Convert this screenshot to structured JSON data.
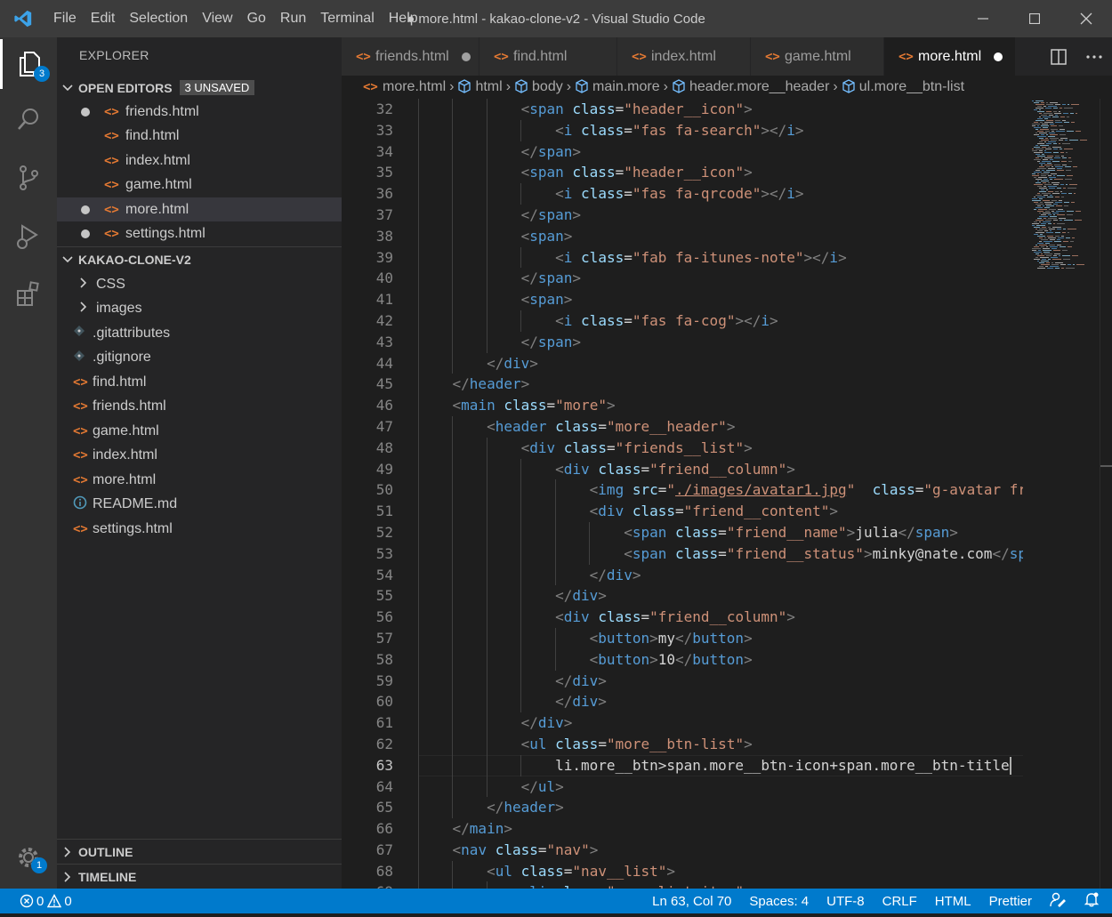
{
  "window": {
    "title": "● more.html - kakao-clone-v2 - Visual Studio Code",
    "menu": [
      "File",
      "Edit",
      "Selection",
      "View",
      "Go",
      "Run",
      "Terminal",
      "Help"
    ]
  },
  "activity_bar": {
    "explorer_badge": "3",
    "settings_badge": "1"
  },
  "sidebar": {
    "title": "EXPLORER",
    "open_editors": {
      "label": "OPEN EDITORS",
      "badge": "3 UNSAVED",
      "items": [
        {
          "name": "friends.html",
          "unsaved": true
        },
        {
          "name": "find.html",
          "unsaved": false
        },
        {
          "name": "index.html",
          "unsaved": false
        },
        {
          "name": "game.html",
          "unsaved": false
        },
        {
          "name": "more.html",
          "unsaved": true
        },
        {
          "name": "settings.html",
          "unsaved": true
        }
      ]
    },
    "project": {
      "label": "KAKAO-CLONE-V2",
      "folders": [
        "CSS",
        "images"
      ],
      "files": [
        {
          "name": ".gitattributes",
          "icon": "git"
        },
        {
          "name": ".gitignore",
          "icon": "git"
        },
        {
          "name": "find.html",
          "icon": "html"
        },
        {
          "name": "friends.html",
          "icon": "html"
        },
        {
          "name": "game.html",
          "icon": "html"
        },
        {
          "name": "index.html",
          "icon": "html"
        },
        {
          "name": "more.html",
          "icon": "html"
        },
        {
          "name": "README.md",
          "icon": "info"
        },
        {
          "name": "settings.html",
          "icon": "html"
        }
      ]
    },
    "outline_label": "OUTLINE",
    "timeline_label": "TIMELINE"
  },
  "tabs": [
    {
      "name": "friends.html",
      "unsaved": true,
      "active": false
    },
    {
      "name": "find.html",
      "unsaved": false,
      "active": false
    },
    {
      "name": "index.html",
      "unsaved": false,
      "active": false
    },
    {
      "name": "game.html",
      "unsaved": false,
      "active": false
    },
    {
      "name": "more.html",
      "unsaved": true,
      "active": true
    }
  ],
  "breadcrumb": [
    "more.html",
    "html",
    "body",
    "main.more",
    "header.more__header",
    "ul.more__btn-list"
  ],
  "editor": {
    "current_line": 63,
    "lines": [
      {
        "n": 32,
        "indent": 3,
        "tokens": [
          [
            "p",
            "<"
          ],
          [
            "t",
            "span"
          ],
          [
            "tx",
            " "
          ],
          [
            "a",
            "class"
          ],
          [
            "tx",
            "="
          ],
          [
            "s",
            "\"header__icon\""
          ],
          [
            "p",
            ">"
          ]
        ]
      },
      {
        "n": 33,
        "indent": 4,
        "tokens": [
          [
            "p",
            "<"
          ],
          [
            "t",
            "i"
          ],
          [
            "tx",
            " "
          ],
          [
            "a",
            "class"
          ],
          [
            "tx",
            "="
          ],
          [
            "s",
            "\"fas fa-search\""
          ],
          [
            "p",
            "></"
          ],
          [
            "t",
            "i"
          ],
          [
            "p",
            ">"
          ]
        ]
      },
      {
        "n": 34,
        "indent": 3,
        "tokens": [
          [
            "p",
            "</"
          ],
          [
            "t",
            "span"
          ],
          [
            "p",
            ">"
          ]
        ]
      },
      {
        "n": 35,
        "indent": 3,
        "tokens": [
          [
            "p",
            "<"
          ],
          [
            "t",
            "span"
          ],
          [
            "tx",
            " "
          ],
          [
            "a",
            "class"
          ],
          [
            "tx",
            "="
          ],
          [
            "s",
            "\"header__icon\""
          ],
          [
            "p",
            ">"
          ]
        ]
      },
      {
        "n": 36,
        "indent": 4,
        "tokens": [
          [
            "p",
            "<"
          ],
          [
            "t",
            "i"
          ],
          [
            "tx",
            " "
          ],
          [
            "a",
            "class"
          ],
          [
            "tx",
            "="
          ],
          [
            "s",
            "\"fas fa-qrcode\""
          ],
          [
            "p",
            "></"
          ],
          [
            "t",
            "i"
          ],
          [
            "p",
            ">"
          ]
        ]
      },
      {
        "n": 37,
        "indent": 3,
        "tokens": [
          [
            "p",
            "</"
          ],
          [
            "t",
            "span"
          ],
          [
            "p",
            ">"
          ]
        ]
      },
      {
        "n": 38,
        "indent": 3,
        "tokens": [
          [
            "p",
            "<"
          ],
          [
            "t",
            "span"
          ],
          [
            "p",
            ">"
          ]
        ]
      },
      {
        "n": 39,
        "indent": 4,
        "tokens": [
          [
            "p",
            "<"
          ],
          [
            "t",
            "i"
          ],
          [
            "tx",
            " "
          ],
          [
            "a",
            "class"
          ],
          [
            "tx",
            "="
          ],
          [
            "s",
            "\"fab fa-itunes-note\""
          ],
          [
            "p",
            "></"
          ],
          [
            "t",
            "i"
          ],
          [
            "p",
            ">"
          ]
        ]
      },
      {
        "n": 40,
        "indent": 3,
        "tokens": [
          [
            "p",
            "</"
          ],
          [
            "t",
            "span"
          ],
          [
            "p",
            ">"
          ]
        ]
      },
      {
        "n": 41,
        "indent": 3,
        "tokens": [
          [
            "p",
            "<"
          ],
          [
            "t",
            "span"
          ],
          [
            "p",
            ">"
          ]
        ]
      },
      {
        "n": 42,
        "indent": 4,
        "tokens": [
          [
            "p",
            "<"
          ],
          [
            "t",
            "i"
          ],
          [
            "tx",
            " "
          ],
          [
            "a",
            "class"
          ],
          [
            "tx",
            "="
          ],
          [
            "s",
            "\"fas fa-cog\""
          ],
          [
            "p",
            "></"
          ],
          [
            "t",
            "i"
          ],
          [
            "p",
            ">"
          ]
        ]
      },
      {
        "n": 43,
        "indent": 3,
        "tokens": [
          [
            "p",
            "</"
          ],
          [
            "t",
            "span"
          ],
          [
            "p",
            ">"
          ]
        ]
      },
      {
        "n": 44,
        "indent": 2,
        "tokens": [
          [
            "p",
            "</"
          ],
          [
            "t",
            "div"
          ],
          [
            "p",
            ">"
          ]
        ]
      },
      {
        "n": 45,
        "indent": 1,
        "tokens": [
          [
            "p",
            "</"
          ],
          [
            "t",
            "header"
          ],
          [
            "p",
            ">"
          ]
        ]
      },
      {
        "n": 46,
        "indent": 1,
        "tokens": [
          [
            "p",
            "<"
          ],
          [
            "t",
            "main"
          ],
          [
            "tx",
            " "
          ],
          [
            "a",
            "class"
          ],
          [
            "tx",
            "="
          ],
          [
            "s",
            "\"more\""
          ],
          [
            "p",
            ">"
          ]
        ]
      },
      {
        "n": 47,
        "indent": 2,
        "tokens": [
          [
            "p",
            "<"
          ],
          [
            "t",
            "header"
          ],
          [
            "tx",
            " "
          ],
          [
            "a",
            "class"
          ],
          [
            "tx",
            "="
          ],
          [
            "s",
            "\"more__header\""
          ],
          [
            "p",
            ">"
          ]
        ]
      },
      {
        "n": 48,
        "indent": 3,
        "tokens": [
          [
            "p",
            "<"
          ],
          [
            "t",
            "div"
          ],
          [
            "tx",
            " "
          ],
          [
            "a",
            "class"
          ],
          [
            "tx",
            "="
          ],
          [
            "s",
            "\"friends__list\""
          ],
          [
            "p",
            ">"
          ]
        ]
      },
      {
        "n": 49,
        "indent": 4,
        "tokens": [
          [
            "p",
            "<"
          ],
          [
            "t",
            "div"
          ],
          [
            "tx",
            " "
          ],
          [
            "a",
            "class"
          ],
          [
            "tx",
            "="
          ],
          [
            "s",
            "\"friend__column\""
          ],
          [
            "p",
            ">"
          ]
        ]
      },
      {
        "n": 50,
        "indent": 5,
        "tokens": [
          [
            "p",
            "<"
          ],
          [
            "t",
            "img"
          ],
          [
            "tx",
            " "
          ],
          [
            "a",
            "src"
          ],
          [
            "tx",
            "="
          ],
          [
            "s",
            "\""
          ],
          [
            "su",
            "./images/avatar1.jpg"
          ],
          [
            "s",
            "\""
          ],
          [
            "tx",
            "  "
          ],
          [
            "a",
            "class"
          ],
          [
            "tx",
            "="
          ],
          [
            "s",
            "\"g-avatar fr"
          ]
        ]
      },
      {
        "n": 51,
        "indent": 5,
        "tokens": [
          [
            "p",
            "<"
          ],
          [
            "t",
            "div"
          ],
          [
            "tx",
            " "
          ],
          [
            "a",
            "class"
          ],
          [
            "tx",
            "="
          ],
          [
            "s",
            "\"friend__content\""
          ],
          [
            "p",
            ">"
          ]
        ]
      },
      {
        "n": 52,
        "indent": 6,
        "tokens": [
          [
            "p",
            "<"
          ],
          [
            "t",
            "span"
          ],
          [
            "tx",
            " "
          ],
          [
            "a",
            "class"
          ],
          [
            "tx",
            "="
          ],
          [
            "s",
            "\"friend__name\""
          ],
          [
            "p",
            ">"
          ],
          [
            "tx",
            "julia"
          ],
          [
            "p",
            "</"
          ],
          [
            "t",
            "span"
          ],
          [
            "p",
            ">"
          ]
        ]
      },
      {
        "n": 53,
        "indent": 6,
        "tokens": [
          [
            "p",
            "<"
          ],
          [
            "t",
            "span"
          ],
          [
            "tx",
            " "
          ],
          [
            "a",
            "class"
          ],
          [
            "tx",
            "="
          ],
          [
            "s",
            "\"friend__status\""
          ],
          [
            "p",
            ">"
          ],
          [
            "tx",
            "minky@nate.com"
          ],
          [
            "p",
            "</"
          ],
          [
            "t",
            "sp"
          ]
        ]
      },
      {
        "n": 54,
        "indent": 5,
        "tokens": [
          [
            "p",
            "</"
          ],
          [
            "t",
            "div"
          ],
          [
            "p",
            ">"
          ]
        ]
      },
      {
        "n": 55,
        "indent": 4,
        "tokens": [
          [
            "p",
            "</"
          ],
          [
            "t",
            "div"
          ],
          [
            "p",
            ">"
          ]
        ]
      },
      {
        "n": 56,
        "indent": 4,
        "tokens": [
          [
            "p",
            "<"
          ],
          [
            "t",
            "div"
          ],
          [
            "tx",
            " "
          ],
          [
            "a",
            "class"
          ],
          [
            "tx",
            "="
          ],
          [
            "s",
            "\"friend__column\""
          ],
          [
            "p",
            ">"
          ]
        ]
      },
      {
        "n": 57,
        "indent": 5,
        "tokens": [
          [
            "p",
            "<"
          ],
          [
            "t",
            "button"
          ],
          [
            "p",
            ">"
          ],
          [
            "tx",
            "my"
          ],
          [
            "p",
            "</"
          ],
          [
            "t",
            "button"
          ],
          [
            "p",
            ">"
          ]
        ]
      },
      {
        "n": 58,
        "indent": 5,
        "tokens": [
          [
            "p",
            "<"
          ],
          [
            "t",
            "button"
          ],
          [
            "p",
            ">"
          ],
          [
            "tx",
            "10"
          ],
          [
            "p",
            "</"
          ],
          [
            "t",
            "button"
          ],
          [
            "p",
            ">"
          ]
        ]
      },
      {
        "n": 59,
        "indent": 4,
        "tokens": [
          [
            "p",
            "</"
          ],
          [
            "t",
            "div"
          ],
          [
            "p",
            ">"
          ]
        ]
      },
      {
        "n": 60,
        "indent": 4,
        "tokens": [
          [
            "p",
            "</"
          ],
          [
            "t",
            "div"
          ],
          [
            "p",
            ">"
          ]
        ]
      },
      {
        "n": 61,
        "indent": 3,
        "tokens": [
          [
            "p",
            "</"
          ],
          [
            "t",
            "div"
          ],
          [
            "p",
            ">"
          ]
        ]
      },
      {
        "n": 62,
        "indent": 3,
        "tokens": [
          [
            "p",
            "<"
          ],
          [
            "t",
            "ul"
          ],
          [
            "tx",
            " "
          ],
          [
            "a",
            "class"
          ],
          [
            "tx",
            "="
          ],
          [
            "s",
            "\"more__btn-list\""
          ],
          [
            "p",
            ">"
          ]
        ]
      },
      {
        "n": 63,
        "indent": 4,
        "tokens": [
          [
            "tx",
            "li.more__btn>span.more__btn-icon+span.more__btn-title"
          ]
        ],
        "cursor": true
      },
      {
        "n": 64,
        "indent": 3,
        "tokens": [
          [
            "p",
            "</"
          ],
          [
            "t",
            "ul"
          ],
          [
            "p",
            ">"
          ]
        ]
      },
      {
        "n": 65,
        "indent": 2,
        "tokens": [
          [
            "p",
            "</"
          ],
          [
            "t",
            "header"
          ],
          [
            "p",
            ">"
          ]
        ]
      },
      {
        "n": 66,
        "indent": 1,
        "tokens": [
          [
            "p",
            "</"
          ],
          [
            "t",
            "main"
          ],
          [
            "p",
            ">"
          ]
        ]
      },
      {
        "n": 67,
        "indent": 1,
        "tokens": [
          [
            "p",
            "<"
          ],
          [
            "t",
            "nav"
          ],
          [
            "tx",
            " "
          ],
          [
            "a",
            "class"
          ],
          [
            "tx",
            "="
          ],
          [
            "s",
            "\"nav\""
          ],
          [
            "p",
            ">"
          ]
        ]
      },
      {
        "n": 68,
        "indent": 2,
        "tokens": [
          [
            "p",
            "<"
          ],
          [
            "t",
            "ul"
          ],
          [
            "tx",
            " "
          ],
          [
            "a",
            "class"
          ],
          [
            "tx",
            "="
          ],
          [
            "s",
            "\"nav__list\""
          ],
          [
            "p",
            ">"
          ]
        ]
      },
      {
        "n": 69,
        "indent": 3,
        "tokens": [
          [
            "p",
            "<"
          ],
          [
            "t",
            "li"
          ],
          [
            "tx",
            " "
          ],
          [
            "a",
            "class"
          ],
          [
            "tx",
            "="
          ],
          [
            "s",
            "\"nav__list-item\""
          ],
          [
            "p",
            ">"
          ]
        ]
      }
    ]
  },
  "statusbar": {
    "errors": "0",
    "warnings": "0",
    "position": "Ln 63, Col 70",
    "spaces": "Spaces: 4",
    "encoding": "UTF-8",
    "eol": "CRLF",
    "language": "HTML",
    "formatter": "Prettier"
  },
  "colors": {
    "accent": "#007acc",
    "html_icon": "#e37933",
    "tag": "#569cd6",
    "attribute": "#9cdcfe",
    "string": "#ce9178"
  }
}
